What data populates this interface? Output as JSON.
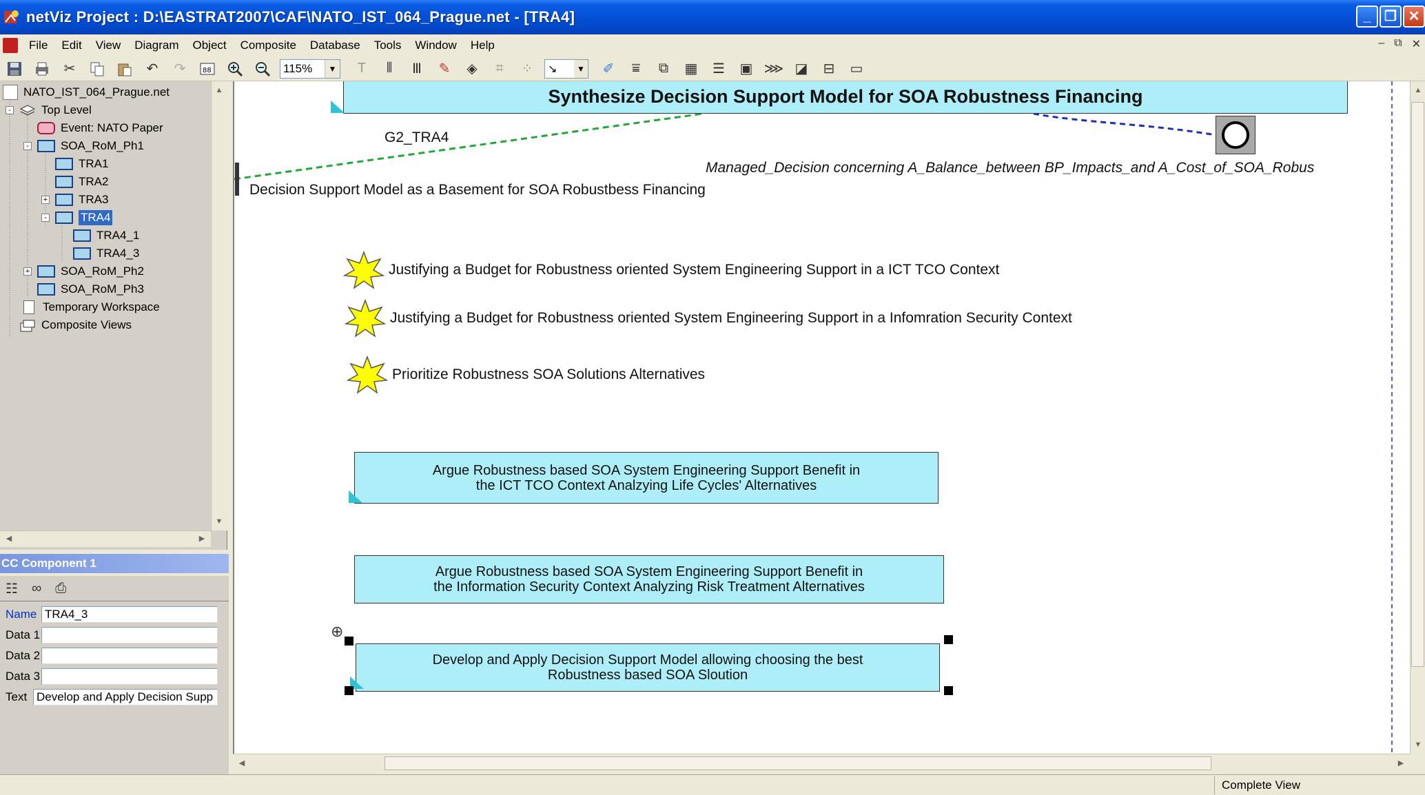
{
  "window": {
    "title": "netViz Project : D:\\EASTRAT2007\\CAF\\NATO_IST_064_Prague.net - [TRA4]",
    "buttons": [
      "_",
      "❐",
      "✕"
    ]
  },
  "menu": [
    "File",
    "Edit",
    "View",
    "Diagram",
    "Object",
    "Composite",
    "Database",
    "Tools",
    "Window",
    "Help"
  ],
  "mdi_buttons": [
    "–",
    "⧉",
    "✕"
  ],
  "toolbar": {
    "zoom": "115%"
  },
  "tree": {
    "nodes": [
      {
        "label": "NATO_IST_064_Prague.net",
        "icon": "project-icon"
      },
      {
        "label": "Top Level",
        "icon": "layers-icon"
      },
      {
        "label": "Event: NATO Paper",
        "icon": "event-icon"
      },
      {
        "label": "SOA_RoM_Ph1",
        "icon": "node-icon"
      },
      {
        "label": "TRA1",
        "icon": "node-icon"
      },
      {
        "label": "TRA2",
        "icon": "node-icon"
      },
      {
        "label": "TRA3",
        "icon": "node-icon"
      },
      {
        "label": "TRA4",
        "icon": "node-icon"
      },
      {
        "label": "TRA4_1",
        "icon": "node-icon"
      },
      {
        "label": "TRA4_3",
        "icon": "node-icon"
      },
      {
        "label": "SOA_RoM_Ph2",
        "icon": "node-icon"
      },
      {
        "label": "SOA_RoM_Ph3",
        "icon": "node-icon"
      },
      {
        "label": "Temporary Workspace",
        "icon": "sheet-icon"
      },
      {
        "label": "Composite Views",
        "icon": "composite-icon"
      }
    ],
    "expanders": [
      "-",
      "-",
      "+",
      "-",
      "+"
    ]
  },
  "props": {
    "header": "CC Component 1",
    "name_label": "Name",
    "name_value": "TRA4_3",
    "data1_label": "Data 1",
    "data1_value": "",
    "data2_label": "Data 2",
    "data2_value": "",
    "data3_label": "Data 3",
    "data3_value": "",
    "text_label": "Text",
    "text_value": "Develop and Apply Decision Supp"
  },
  "canvas": {
    "top_box": "Synthesize Decision Support Model for SOA Robustness Financing",
    "link_label": "G2_TRA4",
    "decision_label": "Managed_Decision concerning A_Balance_between BP_Impacts_and A_Cost_of_SOA_Robus",
    "basement_label": "Decision Support Model as a Basement for SOA Robustbess Financing",
    "stars": [
      "Justifying a Budget for Robustness oriented System Engineering Support in a ICT TCO Context",
      "Justifying a Budget for Robustness oriented System Engineering Support in a Infomration Security Context",
      "Prioritize  Robustness SOA Solutions Alternatives"
    ],
    "boxes": [
      "Argue Robustness based SOA System Engineering Support Benefit in\nthe  ICT TCO Context Analzying Life Cycles' Alternatives",
      "Argue Robustness based SOA System Engineering Support Benefit in\nthe  Information Security Context Analyzing Risk Treatment Alternatives",
      "Develop and Apply Decision Support Model allowing choosing the best\nRobustness based SOA Sloution"
    ]
  },
  "status": {
    "view": "Complete View"
  },
  "colors": {
    "goal_fill": "#aeeef8",
    "star_fill": "#ffff00",
    "link_green": "#22a83a",
    "link_blue": "#1f2fb8",
    "selection": "#316ac5"
  }
}
